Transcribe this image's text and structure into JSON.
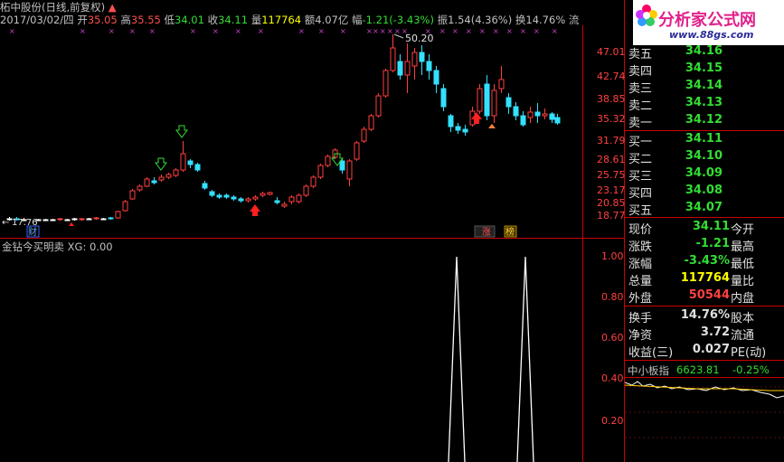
{
  "header": {
    "stock": "柘中股份(日线,前复权)",
    "date": "2017/03/02/四",
    "open_label": "开",
    "open": "35.05",
    "high_label": "高",
    "high": "35.55",
    "low_label": "低",
    "low": "34.01",
    "close_label": "收",
    "close": "34.11",
    "vol_label": "量",
    "vol": "117764",
    "amount_label": "额",
    "amount": "4.07亿",
    "chg_label": "幅",
    "chg": "-1.21",
    "chg_pct": "(-3.43%)",
    "amp_label": "振",
    "amp": "1.54(4.36%)",
    "turnover_label": "换",
    "turnover": "14.76%",
    "float_label": "流"
  },
  "logo": {
    "text": "分析家公式网",
    "url": "www.88gs.com"
  },
  "price_axis": [
    "47.01",
    "42.74",
    "38.85",
    "35.32",
    "31.79",
    "28.61",
    "25.75",
    "23.17",
    "20.85",
    "18.77"
  ],
  "chart_markers": {
    "high_label": "50.20",
    "low_label": "17.76",
    "tag_cai": "财",
    "tag_zhang": "涨",
    "tag_bang": "榜"
  },
  "indicator": {
    "title": "金钻今买明卖",
    "series": "XG: 0.00",
    "axis": [
      "1.00",
      "0.80",
      "0.60",
      "0.40",
      "0.20"
    ]
  },
  "order_book": [
    {
      "label": "卖五",
      "price": "34.16"
    },
    {
      "label": "卖四",
      "price": "34.15"
    },
    {
      "label": "卖三",
      "price": "34.14"
    },
    {
      "label": "卖二",
      "price": "34.13"
    },
    {
      "label": "卖一",
      "price": "34.12"
    },
    {
      "label": "买一",
      "price": "34.11"
    },
    {
      "label": "买二",
      "price": "34.10"
    },
    {
      "label": "买三",
      "price": "34.09"
    },
    {
      "label": "买四",
      "price": "34.08"
    },
    {
      "label": "买五",
      "price": "34.07"
    }
  ],
  "quote": [
    {
      "label": "现价",
      "value": "34.11",
      "label2": "今开",
      "color": "#33dd33"
    },
    {
      "label": "涨跌",
      "value": "-1.21",
      "label2": "最高",
      "color": "#33dd33"
    },
    {
      "label": "涨幅",
      "value": "-3.43%",
      "label2": "最低",
      "color": "#33dd33"
    },
    {
      "label": "总量",
      "value": "117764",
      "label2": "量比",
      "color": "#ffff00"
    },
    {
      "label": "外盘",
      "value": "50544",
      "label2": "内盘",
      "color": "#ff4040"
    },
    {
      "label": "换手",
      "value": "14.76%",
      "label2": "股本",
      "color": "#e0e0e0"
    },
    {
      "label": "净资",
      "value": "3.72",
      "label2": "流通",
      "color": "#e0e0e0"
    },
    {
      "label": "收益(三)",
      "value": "0.027",
      "label2": "PE(动)",
      "color": "#e0e0e0"
    }
  ],
  "index_bar": {
    "name": "中小板指",
    "value": "6623.81",
    "change": "-0.25%"
  },
  "colors": {
    "up": "#ff4040",
    "down": "#33e0ff",
    "flat": "#ffffff",
    "axis": "#cc0000"
  }
}
